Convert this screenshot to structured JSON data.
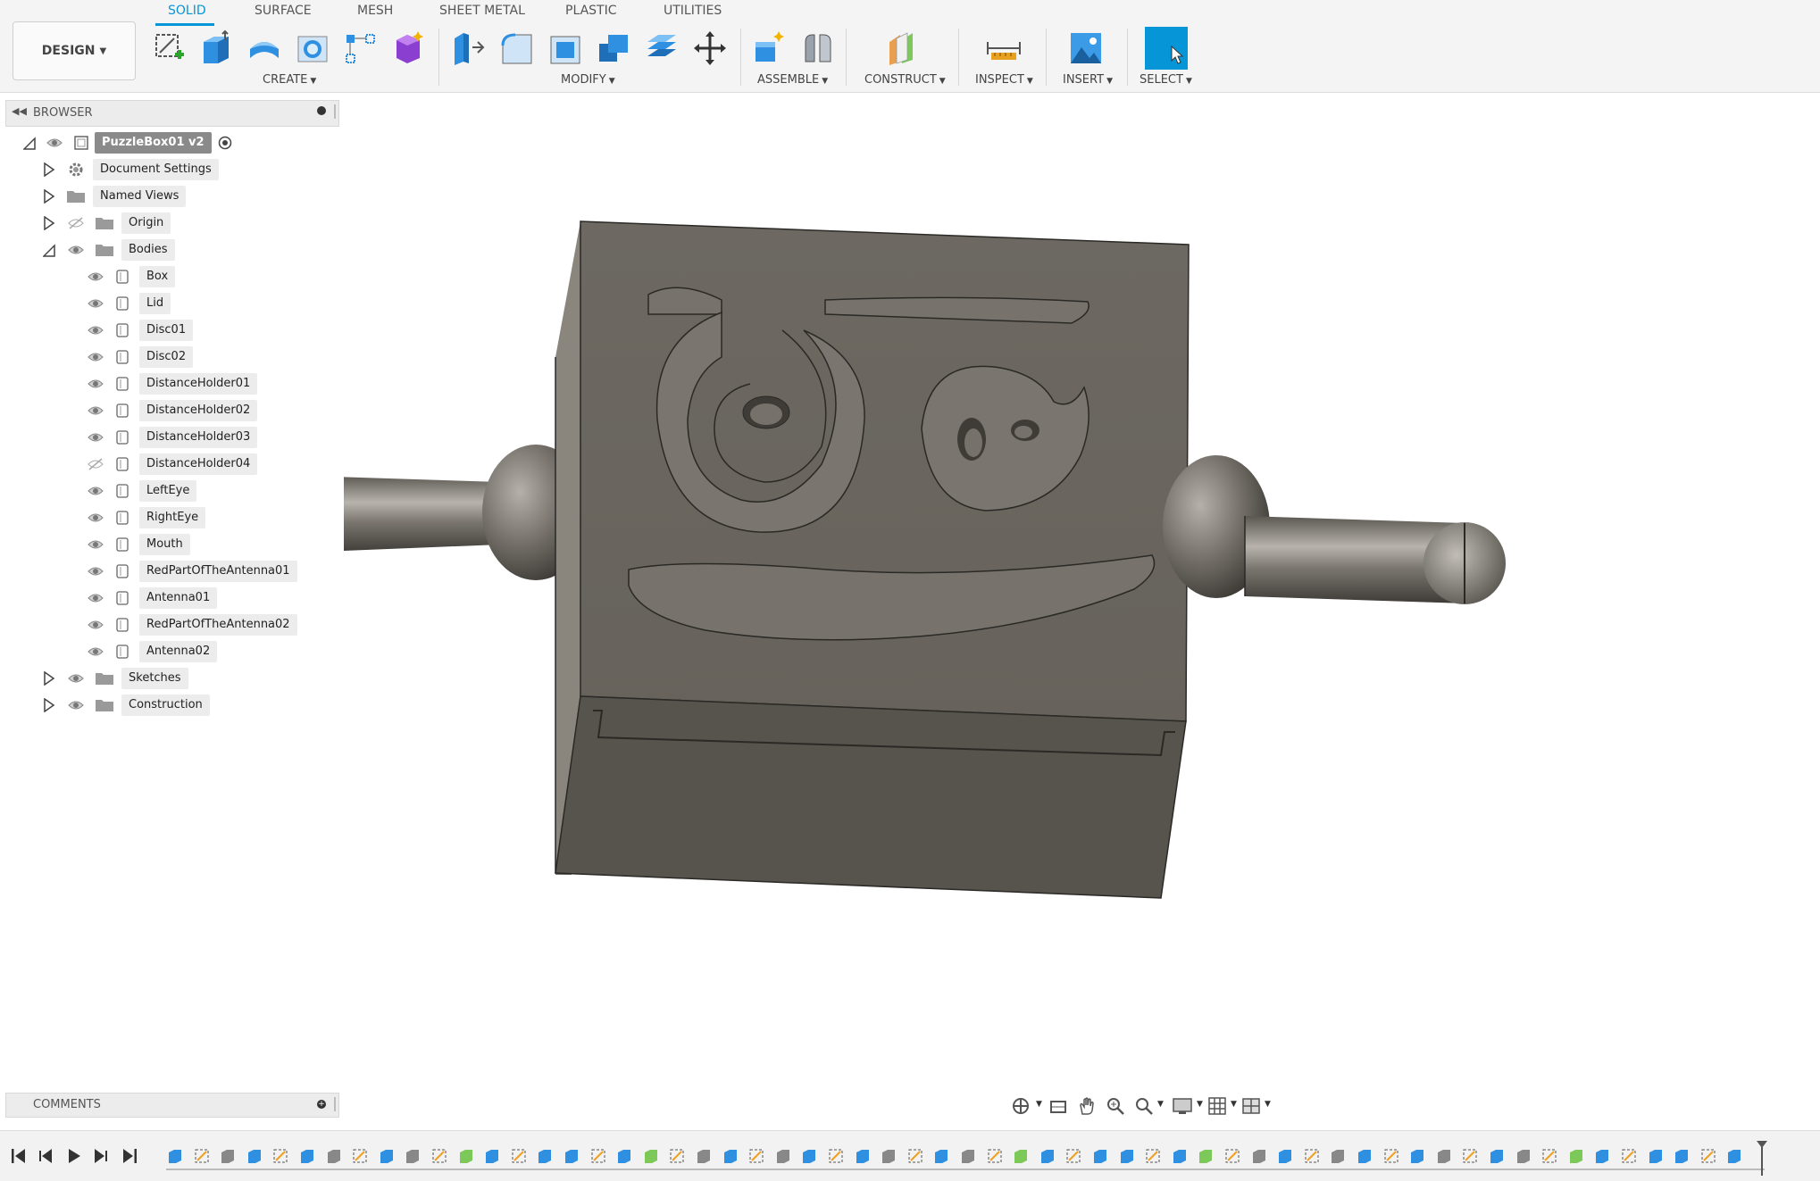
{
  "toolbar": {
    "workspace": "DESIGN",
    "tabs": [
      {
        "label": "SOLID",
        "active": true
      },
      {
        "label": "SURFACE",
        "active": false
      },
      {
        "label": "MESH",
        "active": false
      },
      {
        "label": "SHEET METAL",
        "active": false
      },
      {
        "label": "PLASTIC",
        "active": false
      },
      {
        "label": "UTILITIES",
        "active": false
      }
    ],
    "groups": {
      "create": "CREATE",
      "modify": "MODIFY",
      "assemble": "ASSEMBLE",
      "construct": "CONSTRUCT",
      "inspect": "INSPECT",
      "insert": "INSERT",
      "select": "SELECT"
    }
  },
  "browser": {
    "title": "BROWSER",
    "root": "PuzzleBox01 v2",
    "items": [
      {
        "label": "Document Settings",
        "icon": "gear-icon"
      },
      {
        "label": "Named Views",
        "icon": "folder-icon"
      },
      {
        "label": "Origin",
        "icon": "folder-icon",
        "hidden": true
      },
      {
        "label": "Bodies",
        "icon": "folder-icon",
        "expanded": true
      }
    ],
    "bodies": [
      {
        "label": "Box"
      },
      {
        "label": "Lid"
      },
      {
        "label": "Disc01"
      },
      {
        "label": "Disc02"
      },
      {
        "label": "DistanceHolder01"
      },
      {
        "label": "DistanceHolder02"
      },
      {
        "label": "DistanceHolder03"
      },
      {
        "label": "DistanceHolder04",
        "hidden": true
      },
      {
        "label": "LeftEye"
      },
      {
        "label": "RightEye"
      },
      {
        "label": "Mouth"
      },
      {
        "label": "RedPartOfTheAntenna01"
      },
      {
        "label": "Antenna01"
      },
      {
        "label": "RedPartOfTheAntenna02"
      },
      {
        "label": "Antenna02"
      }
    ],
    "after": [
      {
        "label": "Sketches"
      },
      {
        "label": "Construction"
      }
    ]
  },
  "comments": {
    "title": "COMMENTS"
  },
  "colors": {
    "accent": "#0696d7",
    "model": "#6b6760",
    "panel": "#ececec"
  }
}
